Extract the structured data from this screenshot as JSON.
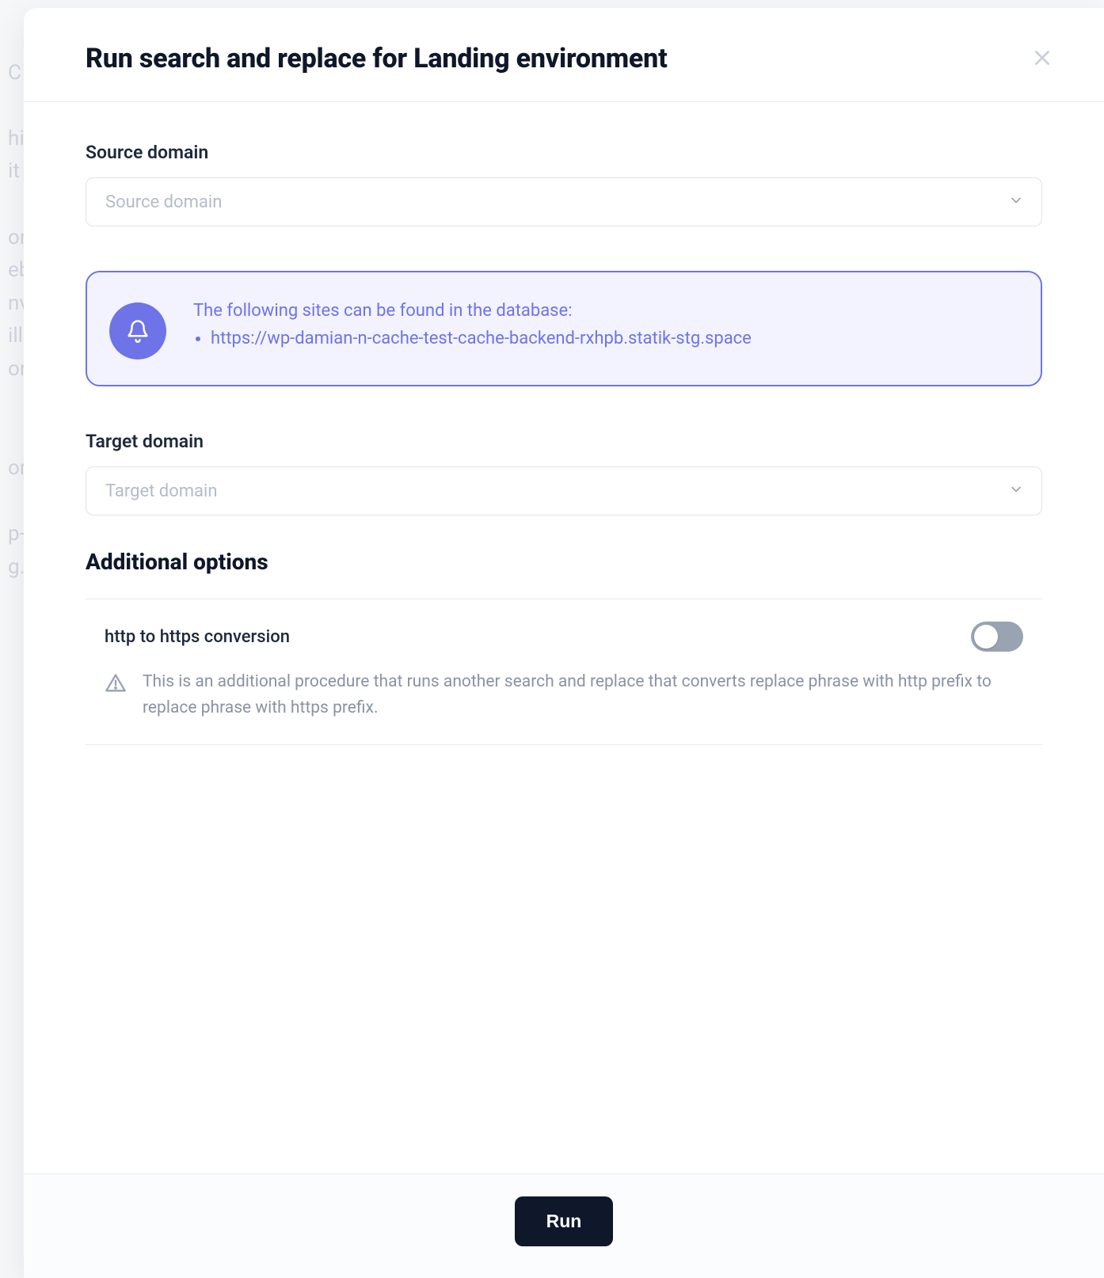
{
  "modal": {
    "title": "Run search and replace for Landing environment"
  },
  "source": {
    "label": "Source domain",
    "placeholder": "Source domain"
  },
  "info": {
    "heading": "The following sites can be found in the database:",
    "sites": [
      "https://wp-damian-n-cache-test-cache-backend-rxhpb.statik-stg.space"
    ]
  },
  "target": {
    "label": "Target domain",
    "placeholder": "Target domain"
  },
  "additional": {
    "heading": "Additional options",
    "http_https": {
      "title": "http to https conversion",
      "enabled": false,
      "description": "This is an additional procedure that runs another search and replace that converts replace phrase with http prefix to replace phrase with https prefix."
    }
  },
  "footer": {
    "run_label": "Run"
  }
}
